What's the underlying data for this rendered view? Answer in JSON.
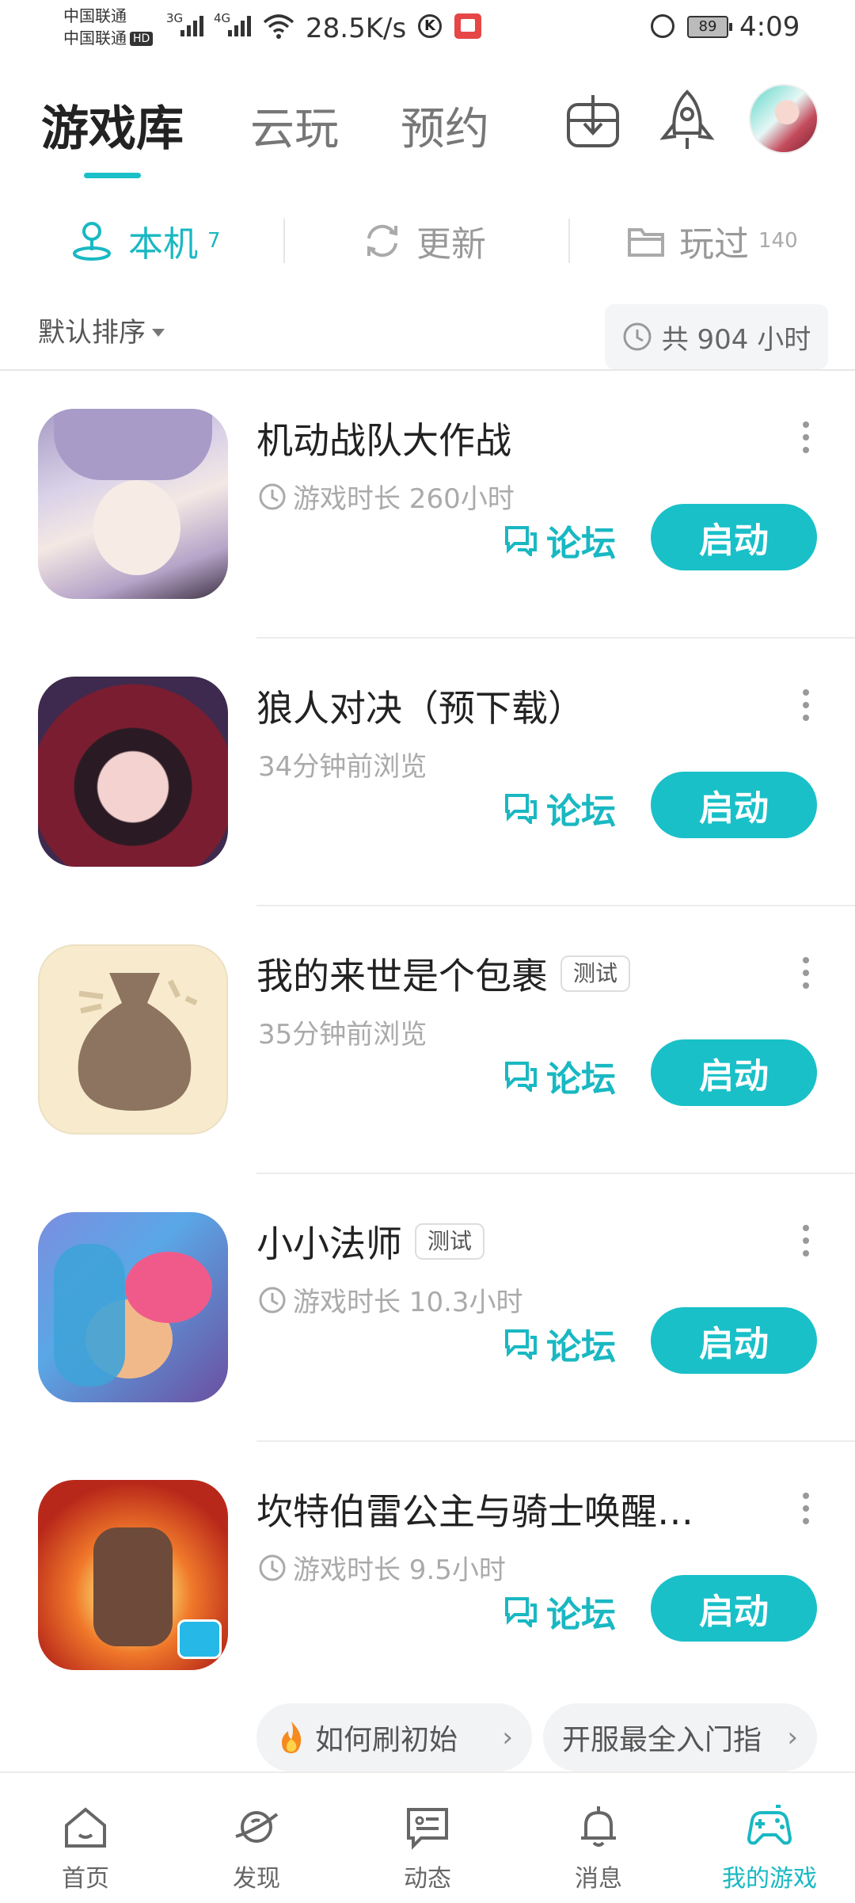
{
  "status_bar": {
    "carrier_1": "中国联通",
    "carrier_2": "中国联通",
    "carrier_2_badge": "HD",
    "sig1": "3G",
    "sig2": "4G",
    "speed": "28.5K/s",
    "k_icon_text": "K",
    "battery": "89",
    "time": "4:09"
  },
  "header": {
    "tabs": [
      {
        "label": "游戏库",
        "active": true
      },
      {
        "label": "云玩",
        "active": false
      },
      {
        "label": "预约",
        "active": false
      }
    ],
    "download_icon": "download-box-icon",
    "rocket_icon": "rocket-icon",
    "avatar": "user-avatar"
  },
  "subtabs": [
    {
      "label": "本机",
      "count": "7",
      "icon": "user-stand-icon",
      "active": true
    },
    {
      "label": "更新",
      "count": "",
      "icon": "refresh-icon",
      "active": false
    },
    {
      "label": "玩过",
      "count": "140",
      "icon": "folder-icon",
      "active": false
    }
  ],
  "sort": {
    "label": "默认排序"
  },
  "total_time": {
    "label": "共 904 小时"
  },
  "games": [
    {
      "name": "机动战队大作战",
      "badge": "",
      "sub": "游戏时长 260小时",
      "has_clock": true,
      "forum": "论坛",
      "launch": "启动"
    },
    {
      "name": "狼人对决（预下载）",
      "badge": "",
      "sub": "34分钟前浏览",
      "has_clock": false,
      "forum": "论坛",
      "launch": "启动"
    },
    {
      "name": "我的来世是个包裹",
      "badge": "测试",
      "sub": "35分钟前浏览",
      "has_clock": false,
      "forum": "论坛",
      "launch": "启动"
    },
    {
      "name": "小小法师",
      "badge": "测试",
      "sub": "游戏时长 10.3小时",
      "has_clock": true,
      "forum": "论坛",
      "launch": "启动"
    },
    {
      "name": "坎特伯雷公主与骑士唤醒…",
      "badge": "",
      "sub": "游戏时长 9.5小时",
      "has_clock": true,
      "forum": "论坛",
      "launch": "启动"
    }
  ],
  "chips": [
    {
      "label": "如何刷初始",
      "icon": "fire-icon"
    },
    {
      "label": "开服最全入门指"
    }
  ],
  "bottom_nav": [
    {
      "label": "首页",
      "icon": "home-icon",
      "active": false
    },
    {
      "label": "发现",
      "icon": "planet-icon",
      "active": false
    },
    {
      "label": "动态",
      "icon": "chat-card-icon",
      "active": false
    },
    {
      "label": "消息",
      "icon": "bell-icon",
      "active": false
    },
    {
      "label": "我的游戏",
      "icon": "gamepad-icon",
      "active": true
    }
  ],
  "colors": {
    "accent": "#19c0c8",
    "text": "#222222",
    "muted": "#aaaaaa"
  }
}
